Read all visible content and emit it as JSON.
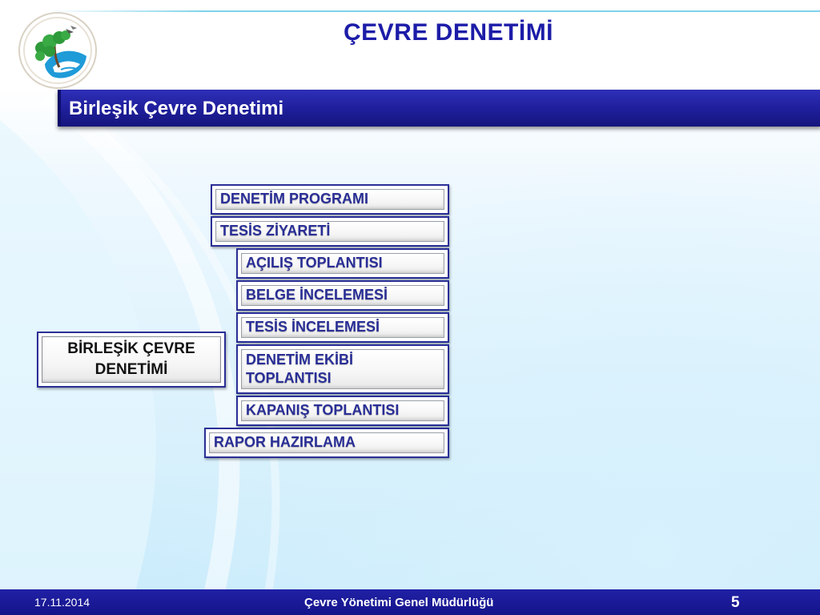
{
  "slide": {
    "title": "ÇEVRE DENETİMİ",
    "subtitle": "Birleşik Çevre Denetimi"
  },
  "diagram": {
    "root": "BİRLEŞİK ÇEVRE DENETİMİ",
    "steps": [
      {
        "label": "DENETİM PROGRAMI",
        "level": 0
      },
      {
        "label": "TESİS ZİYARETİ",
        "level": 0
      },
      {
        "label": "AÇILIŞ TOPLANTISI",
        "level": 1
      },
      {
        "label": "BELGE İNCELEMESİ",
        "level": 1
      },
      {
        "label": "TESİS İNCELEMESİ",
        "level": 1
      },
      {
        "label": "DENETİM EKİBİ TOPLANTISI",
        "level": 1
      },
      {
        "label": "KAPANIŞ TOPLANTISI",
        "level": 1
      },
      {
        "label": "RAPOR HAZIRLAMA",
        "level": 0
      }
    ]
  },
  "footer": {
    "date": "17.11.2014",
    "organization": "Çevre Yönetimi Genel Müdürlüğü",
    "page_number": "5"
  },
  "colors": {
    "title": "#1c1ca8",
    "accent_bar": "#1e1e9a",
    "box_border": "#2a2f96",
    "footer_bg": "#14148a"
  },
  "icons": {
    "logo": "ministry-logo-icon"
  }
}
